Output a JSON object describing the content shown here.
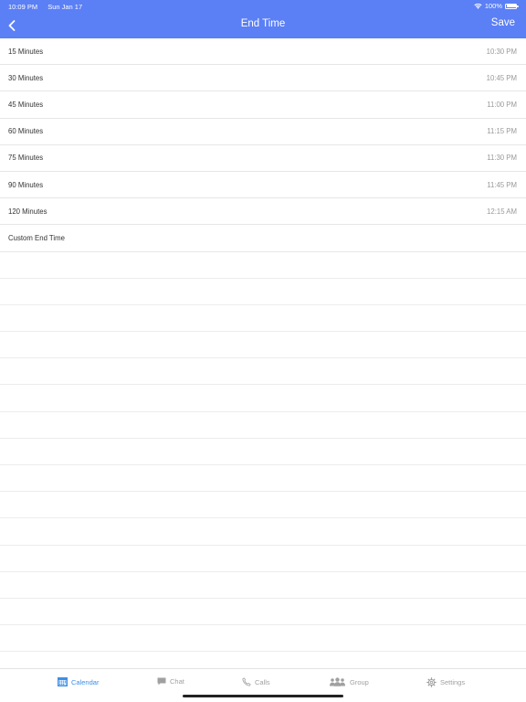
{
  "status_bar": {
    "time": "10:09 PM",
    "date": "Sun Jan 17",
    "battery_text": "100%",
    "icons": [
      "wifi-icon",
      "battery-icon"
    ]
  },
  "nav": {
    "title": "End Time",
    "save_label": "Save",
    "back_icon": "chevron-left-icon"
  },
  "options": [
    {
      "label": "15 Minutes",
      "time": "10:30 PM"
    },
    {
      "label": "30 Minutes",
      "time": "10:45 PM"
    },
    {
      "label": "45 Minutes",
      "time": "11:00 PM"
    },
    {
      "label": "60 Minutes",
      "time": "11:15 PM"
    },
    {
      "label": "75 Minutes",
      "time": "11:30 PM"
    },
    {
      "label": "90 Minutes",
      "time": "11:45 PM"
    },
    {
      "label": "120 Minutes",
      "time": "12:15 AM"
    },
    {
      "label": "Custom End Time",
      "time": ""
    }
  ],
  "tabbar": {
    "calendar": "Calendar",
    "chat": "Chat",
    "calls": "Calls",
    "group": "Group",
    "settings": "Settings"
  },
  "colors": {
    "header": "#5b7ff5",
    "accent": "#3d8fe6",
    "tab_inactive": "#a0a0a0"
  }
}
